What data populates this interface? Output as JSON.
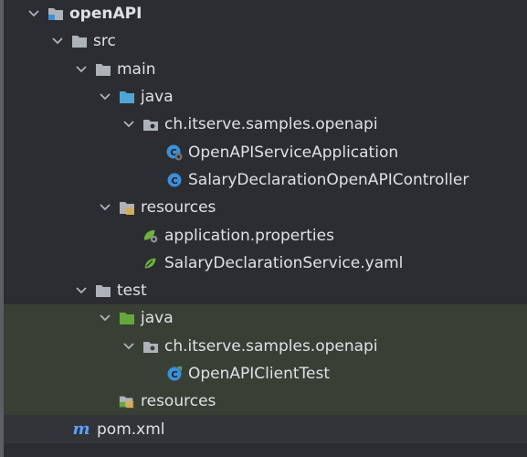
{
  "tree": {
    "root": "openAPI",
    "src": "src",
    "main": "main",
    "main_java": "java",
    "main_pkg": "ch.itserve.samples.openapi",
    "main_app": "OpenAPIServiceApplication",
    "main_ctrl": "SalaryDeclarationOpenAPIController",
    "resources": "resources",
    "app_props": "application.properties",
    "yaml": "SalaryDeclarationService.yaml",
    "test": "test",
    "test_java": "java",
    "test_pkg": "ch.itserve.samples.openapi",
    "test_class": "OpenAPIClientTest",
    "test_resources": "resources",
    "pom": "pom.xml",
    "maven_glyph": "m"
  },
  "colors": {
    "background": "#2b2d30",
    "highlight": "#384036",
    "folder": "#aeb3b9",
    "source_folder": "#4ea6d6",
    "test_folder": "#64a83c",
    "class_icon": "#3c8fd8",
    "maven": "#5aa0ff"
  }
}
